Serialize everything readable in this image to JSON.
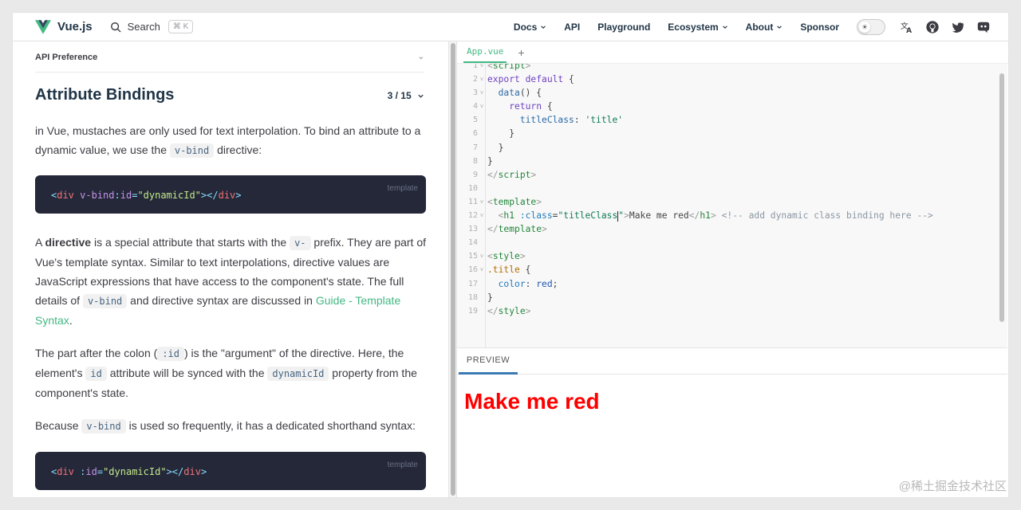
{
  "nav": {
    "brand": "Vue.js",
    "search_label": "Search",
    "search_shortcut": "⌘ K",
    "items": [
      "Docs",
      "API",
      "Playground",
      "Ecosystem",
      "About",
      "Sponsor"
    ]
  },
  "left": {
    "api_preference": "API Preference",
    "title": "Attribute Bindings",
    "step": "3 / 15",
    "p1_a": "in Vue, mustaches are only used for text interpolation. To bind an attribute to a dynamic value, we use the ",
    "p1_code": "v-bind",
    "p1_b": " directive:",
    "code1_lang": "template",
    "p2_a": "A ",
    "p2_bold": "directive",
    "p2_b": " is a special attribute that starts with the ",
    "p2_code1": "v-",
    "p2_c": " prefix. They are part of Vue's template syntax. Similar to text interpolations, directive values are JavaScript expressions that have access to the component's state. The full details of ",
    "p2_code2": "v-bind",
    "p2_d": " and directive syntax are discussed in ",
    "p2_link": "Guide - Template Syntax",
    "p2_e": ".",
    "p3_a": "The part after the colon (",
    "p3_code1": ":id",
    "p3_b": ") is the \"argument\" of the directive. Here, the element's ",
    "p3_code2": "id",
    "p3_c": " attribute will be synced with the ",
    "p3_code3": "dynamicId",
    "p3_d": " property from the component's state.",
    "p4_a": "Because ",
    "p4_code": "v-bind",
    "p4_b": " is used so frequently, it has a dedicated shorthand syntax:",
    "code2_lang": "template"
  },
  "editor": {
    "file_tab": "App.vue",
    "add_tab": "+",
    "preview_tab": "PREVIEW",
    "preview_text": "Make me red"
  },
  "watermark": "@稀土掘金技术社区",
  "colors": {
    "accent": "#42b883",
    "preview_red": "#ff0000",
    "code_bg": "#242838"
  }
}
